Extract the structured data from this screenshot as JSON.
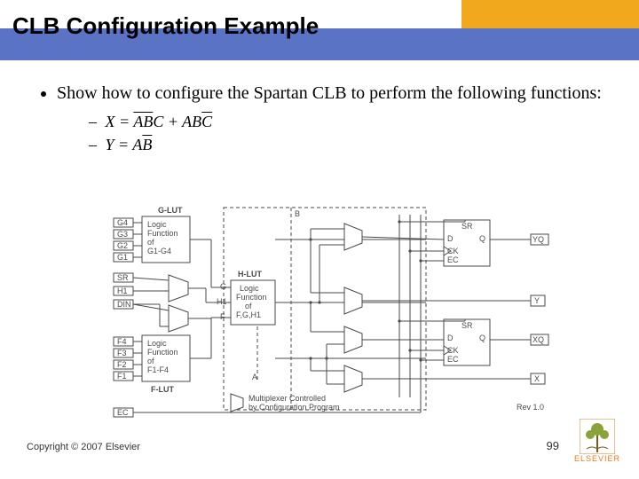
{
  "header": {
    "title": "CLB Configuration Example"
  },
  "bullets": {
    "item1": "Show how to configure the Spartan CLB to perform the following functions:",
    "fnX_lhs": "X = ",
    "fnX_t1a": "A",
    "fnX_t1b": "B",
    "fnX_t1c": "C",
    "fnX_plus": " + ",
    "fnX_t2a": "A",
    "fnX_t2b": "B",
    "fnX_t2c": "C",
    "fnY_lhs": "Y = ",
    "fnY_a": "A",
    "fnY_b": "B"
  },
  "diagram": {
    "label_glut": "G-LUT",
    "label_hlut": "H-LUT",
    "label_flut": "F-LUT",
    "g": {
      "p4": "G4",
      "p3": "G3",
      "p2": "G2",
      "p1": "G1",
      "txt1": "Logic",
      "txt2": "Function",
      "txt3": "of",
      "txt4": "G1-G4"
    },
    "h": {
      "p_g": "G",
      "p_h1": "H1",
      "p_f": "F",
      "txt1": "Logic",
      "txt2": "Function",
      "txt3": "of",
      "txt4": "F,G,H1"
    },
    "f": {
      "p4": "F4",
      "p3": "F3",
      "p2": "F2",
      "p1": "F1",
      "txt1": "Logic",
      "txt2": "Function",
      "txt3": "of",
      "txt4": "F1-F4"
    },
    "left": {
      "sr": "SR",
      "h1": "H1",
      "din": "DIN",
      "ec": "EC"
    },
    "mid": {
      "a": "A",
      "b": "B"
    },
    "ff": {
      "sr": "SR",
      "d": "D",
      "q": "Q",
      "ck": "CK",
      "ec": "EC"
    },
    "out": {
      "yq": "YQ",
      "y": "Y",
      "xq": "XQ",
      "x": "X"
    },
    "mux_note1": "Multiplexer Controlled",
    "mux_note2": "by Configuration Program",
    "rev": "Rev 1.0"
  },
  "footer": {
    "left": "Copyright © 2007 Elsevier",
    "page": "99",
    "logo": "ELSEVIER"
  }
}
